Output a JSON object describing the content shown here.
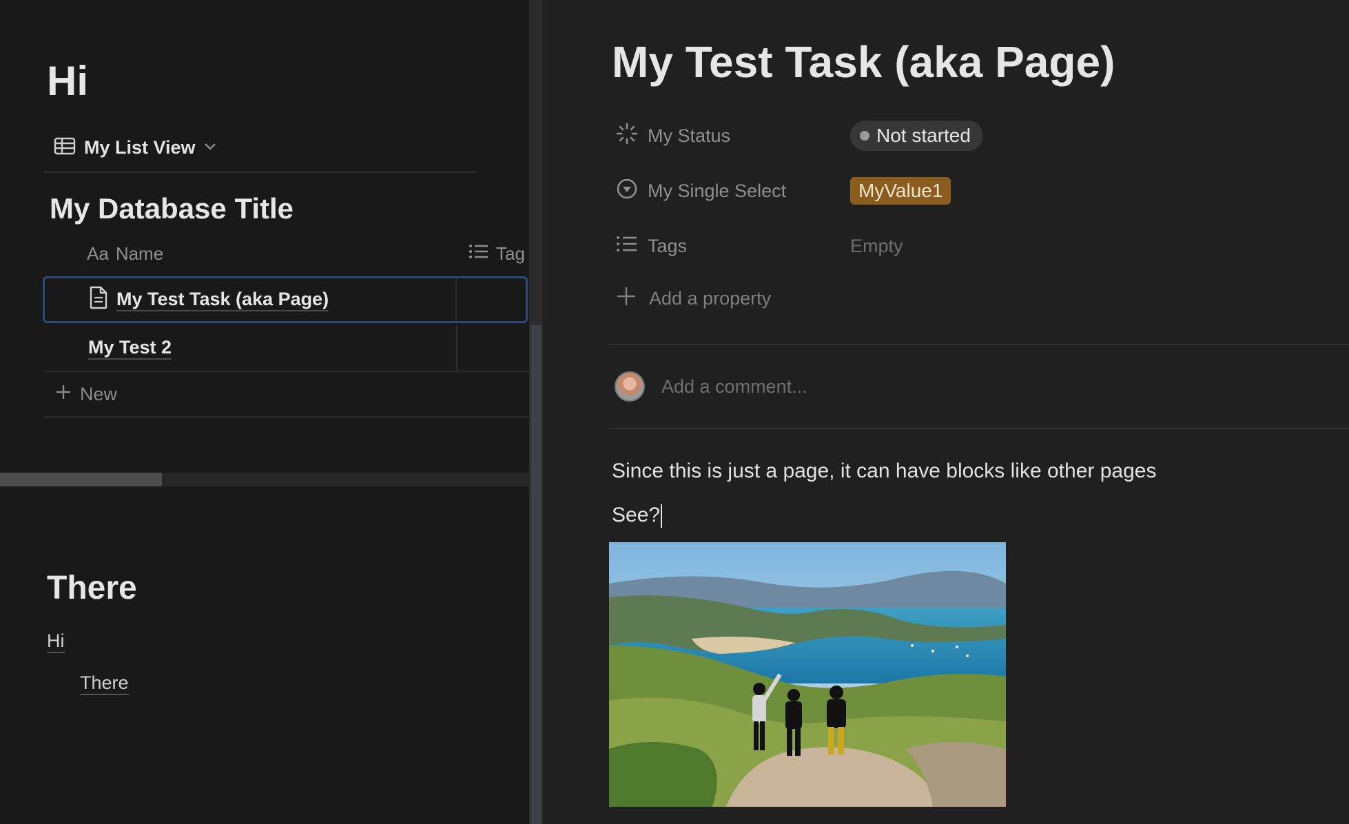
{
  "left_page": {
    "heading": "Hi",
    "view_tab": {
      "label": "My List View",
      "icon": "table-icon",
      "chevron": "chevron-down-icon"
    },
    "database": {
      "title": "My Database Title",
      "columns": [
        {
          "prefix": "Aa",
          "label": "Name"
        },
        {
          "icon": "list-icon",
          "label": "Tag"
        }
      ],
      "rows": [
        {
          "name": "My Test Task (aka Page)",
          "icon": "page-icon",
          "selected": true
        },
        {
          "name": "My Test 2",
          "selected": false
        }
      ],
      "new_label": "New"
    },
    "section_heading": "There",
    "links": [
      "Hi",
      "There"
    ]
  },
  "peek_page": {
    "title": "My Test Task (aka Page)",
    "properties": [
      {
        "icon": "status-icon",
        "name": "My Status",
        "value": "Not started",
        "type": "status"
      },
      {
        "icon": "select-icon",
        "name": "My Single Select",
        "value": "MyValue1",
        "type": "select",
        "color": "#8a5d1e"
      },
      {
        "icon": "list-icon",
        "name": "Tags",
        "value": "Empty",
        "type": "empty"
      }
    ],
    "add_property": "Add a property",
    "comment_placeholder": "Add a comment...",
    "blocks": [
      "Since this is just a page, it can have blocks like other pages",
      "See?"
    ],
    "image_subject": "coastal-landscape-photo"
  },
  "colors": {
    "background": "#191919",
    "peek_background": "#202020",
    "selection_border": "#2a4a78",
    "select_tag": "#8a5d1e"
  }
}
